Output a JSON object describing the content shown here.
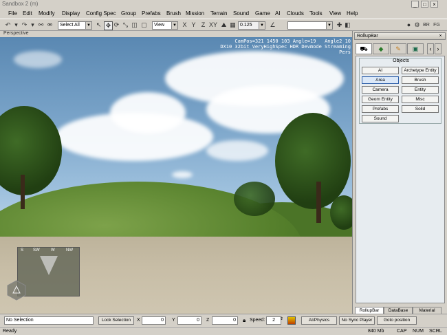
{
  "title": "Sandbox 2 (m)",
  "menu": [
    "File",
    "Edit",
    "Modify",
    "Display",
    "Config Spec",
    "Group",
    "Prefabs",
    "Brush",
    "Mission",
    "Terrain",
    "Sound",
    "Game",
    "AI",
    "Clouds",
    "Tools",
    "View",
    "Help"
  ],
  "toolbar": {
    "selection_combo": "Select All",
    "coord_combo": "View",
    "grid_value": "0.125",
    "layer_combo": "",
    "icon_labels": [
      "BR",
      "FG"
    ]
  },
  "viewport": {
    "label": "Perspective",
    "cam_info_line1": "CamPos=321 1450 103 Angle=19   Angle2 10",
    "cam_info_line2": "DX10 32bit VeryHighSpec HDR Devmode Streaming",
    "cam_info_line3": "Pers",
    "compass_labels": [
      "S",
      "SW",
      "W",
      "NW"
    ]
  },
  "rollup": {
    "title": "RollupBar",
    "tabs": [
      "create-icon",
      "terrain-icon",
      "modify-icon",
      "display-icon"
    ],
    "group_title": "Objects",
    "buttons": [
      "AI",
      "Archetype Entity",
      "Area",
      "Brush",
      "Camera",
      "Entity",
      "Geom Entity",
      "Misc",
      "Prefabs",
      "Solid",
      "Sound"
    ],
    "active_button": "Area",
    "bottom_tabs": [
      "RollupBar",
      "DataBase",
      "Material"
    ]
  },
  "bottom": {
    "selection": "No Selection",
    "lock_selection": "Lock Selection",
    "x_label": "X",
    "x_value": "0",
    "y_label": "Y",
    "y_value": "0",
    "z_label": "Z",
    "z_value": "0",
    "speed_label": "Speed:",
    "speed_value": "2",
    "ai_physics": "AI/Physics",
    "no_sync": "No Sync Player",
    "goto": "Goto position"
  },
  "status": {
    "left": "Ready",
    "memory": "840 Mb",
    "cap": "CAP",
    "num": "NUM",
    "scrl": "SCRL"
  },
  "colors": {
    "accent": "#2d5ea8",
    "sky": "#7aa4c9",
    "grass": "#5e8a35",
    "ground": "#c7bda6"
  }
}
